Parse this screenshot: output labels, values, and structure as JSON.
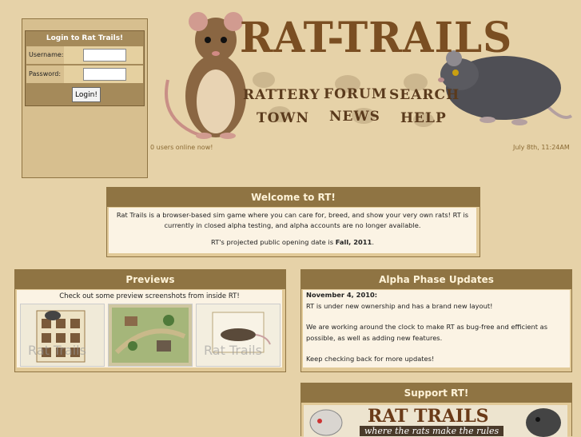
{
  "login": {
    "title": "Login to Rat Trails!",
    "username_label": "Username:",
    "password_label": "Password:",
    "username_value": "",
    "password_value": "",
    "button": "Login!"
  },
  "header": {
    "logo_text": "RAT-TRAILS",
    "nav": [
      "RATTERY",
      "FORUM",
      "SEARCH",
      "TOWN",
      "NEWS",
      "HELP"
    ]
  },
  "status": {
    "online": "0 users online now!",
    "datetime": "July 8th, 11:24AM"
  },
  "welcome": {
    "title": "Welcome to RT!",
    "body": "Rat Trails is a browser-based sim game where you can care for, breed, and show your very own rats! RT is currently in closed alpha testing, and alpha accounts are no longer available.",
    "opening_prefix": "RT's projected public opening date is ",
    "opening_date": "Fall, 2011",
    "opening_suffix": "."
  },
  "previews": {
    "title": "Previews",
    "subtitle": "Check out some preview screenshots from inside RT!",
    "watermark": "Rat Trails"
  },
  "alpha": {
    "title": "Alpha Phase Updates",
    "date": "November 4, 2010:",
    "lines": [
      "RT is under new ownership and has a brand new layout!",
      "We are working around the clock to make RT as bug-free and efficient as possible, as well as adding new features.",
      "Keep checking back for more updates!"
    ]
  },
  "support": {
    "title": "Support RT!",
    "banner_text": "RAT TRAILS",
    "banner_tagline": "where the rats make the rules"
  }
}
